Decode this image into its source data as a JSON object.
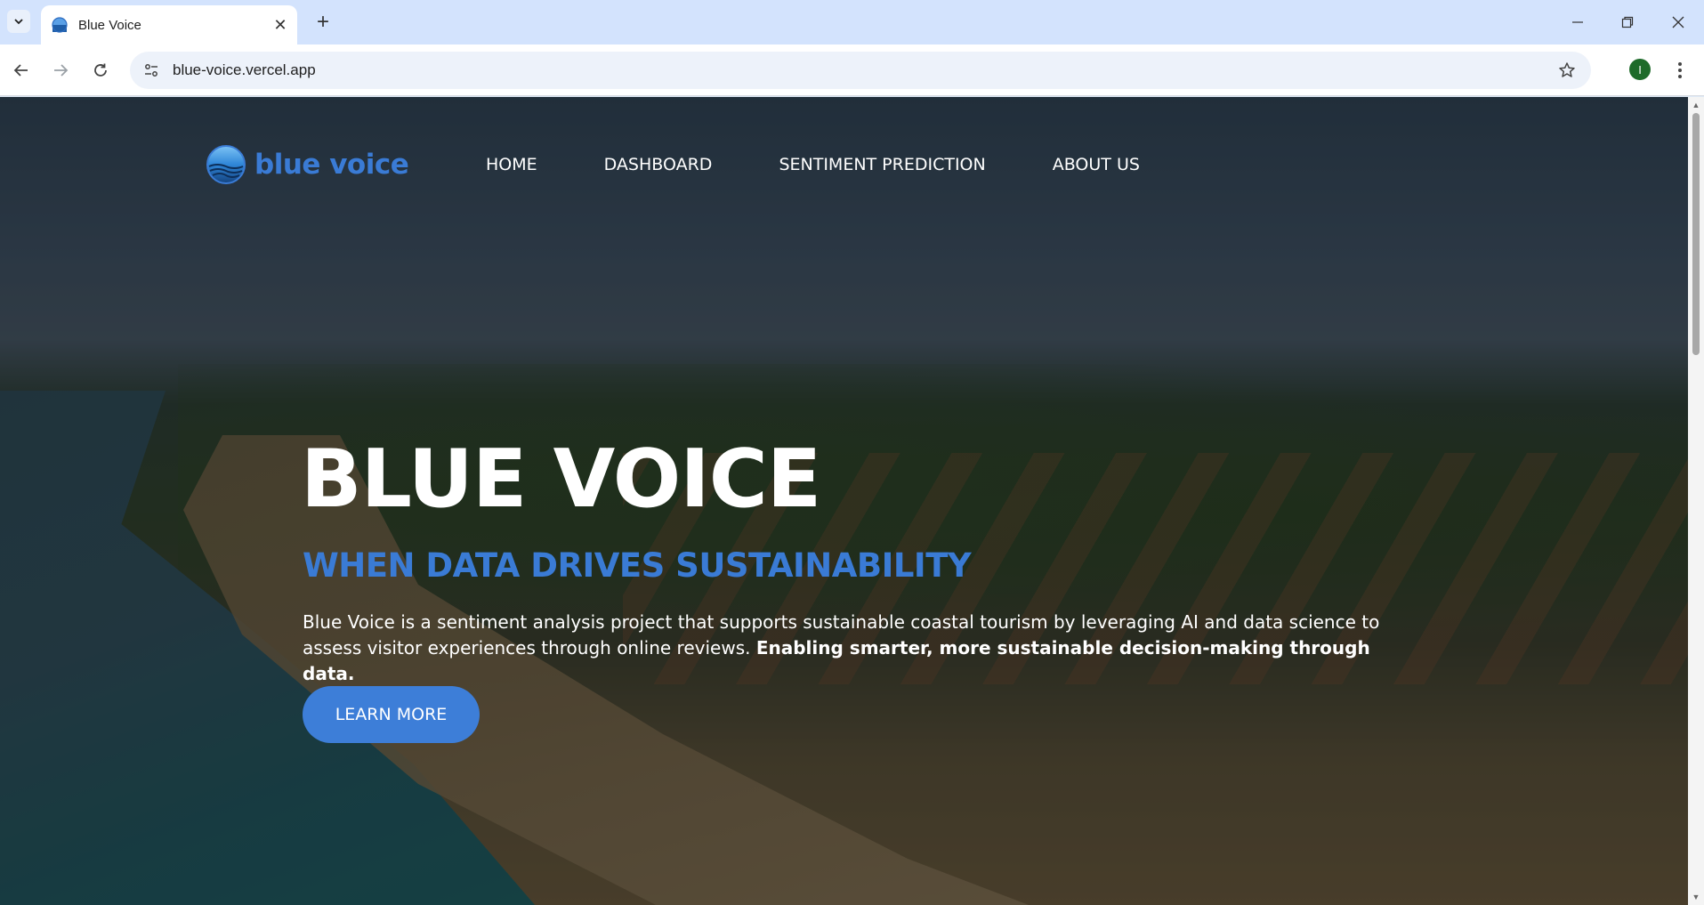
{
  "browser": {
    "tab_title": "Blue Voice",
    "url": "blue-voice.vercel.app",
    "profile_initial": "I"
  },
  "site": {
    "logo_text": "blue voice",
    "nav": [
      {
        "label": "HOME"
      },
      {
        "label": "DASHBOARD"
      },
      {
        "label": "SENTIMENT PREDICTION"
      },
      {
        "label": "ABOUT US"
      }
    ]
  },
  "hero": {
    "title": "BLUE VOICE",
    "subtitle": "WHEN DATA DRIVES SUSTAINABILITY",
    "description": "Blue Voice is a sentiment analysis project that supports sustainable coastal tourism by leveraging AI and data science to assess visitor experiences through online reviews.",
    "description_bold": "Enabling smarter, more sustainable decision-making through data.",
    "cta_label": "LEARN MORE"
  },
  "colors": {
    "accent": "#3a7bd5",
    "tabstrip": "#d3e3fd",
    "button": "#3d7ed8"
  }
}
